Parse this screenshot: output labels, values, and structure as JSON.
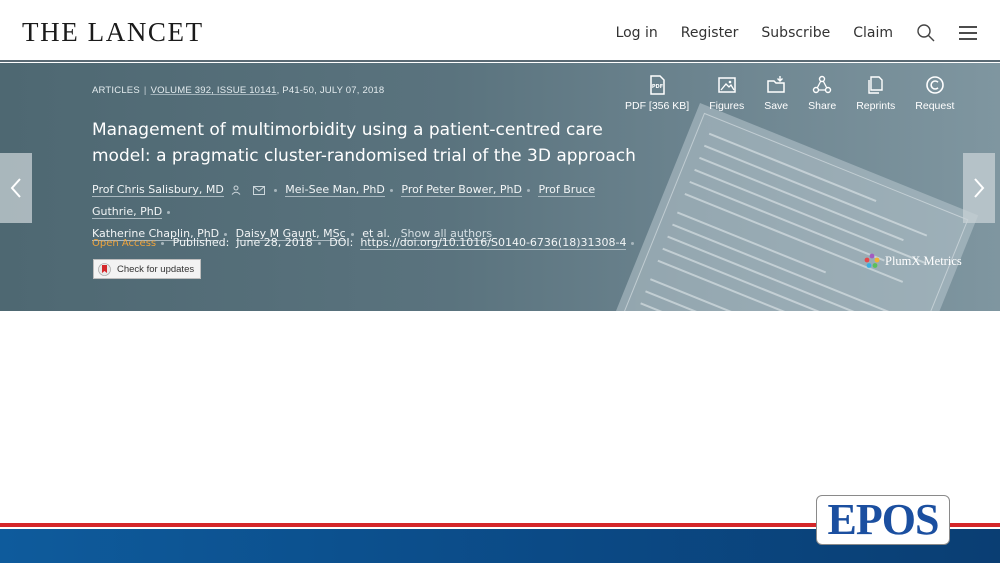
{
  "header": {
    "logo": "THE LANCET",
    "nav": {
      "login": "Log in",
      "register": "Register",
      "subscribe": "Subscribe",
      "claim": "Claim"
    }
  },
  "article": {
    "type": "ARTICLES",
    "volume": "VOLUME 392, ISSUE 10141",
    "pages_date": ", P41-50, JULY 07, 2018",
    "title": "Management of multimorbidity using a patient-centred care model: a pragmatic cluster-randomised trial of the 3D approach",
    "authors": [
      "Prof Chris Salisbury, MD",
      "Mei-See Man, PhD",
      "Prof Peter Bower, PhD",
      "Prof Bruce Guthrie, PhD",
      "Katherine Chaplin, PhD",
      "Daisy M Gaunt, MSc"
    ],
    "et_al": "et al.",
    "show_all": "Show all authors",
    "open_access": "Open Access",
    "published_label": "Published:",
    "published_date": "June 28, 2018",
    "doi_label": "DOI:",
    "doi": "https://doi.org/10.1016/S0140-6736(18)31308-4",
    "check_updates": "Check for updates"
  },
  "tools": {
    "pdf": "PDF [356 KB]",
    "figures": "Figures",
    "save": "Save",
    "share": "Share",
    "reprints": "Reprints",
    "request": "Request"
  },
  "plumx": "PlumX Metrics",
  "footer": {
    "logo": "EPOS"
  },
  "colors": {
    "hero": "#5a737e",
    "open_access": "#f0a43c",
    "red_bar": "#d4272a",
    "blue_bar": "#0b4a86",
    "epos_blue": "#1b4fa0",
    "epos_red": "#d4272a"
  }
}
